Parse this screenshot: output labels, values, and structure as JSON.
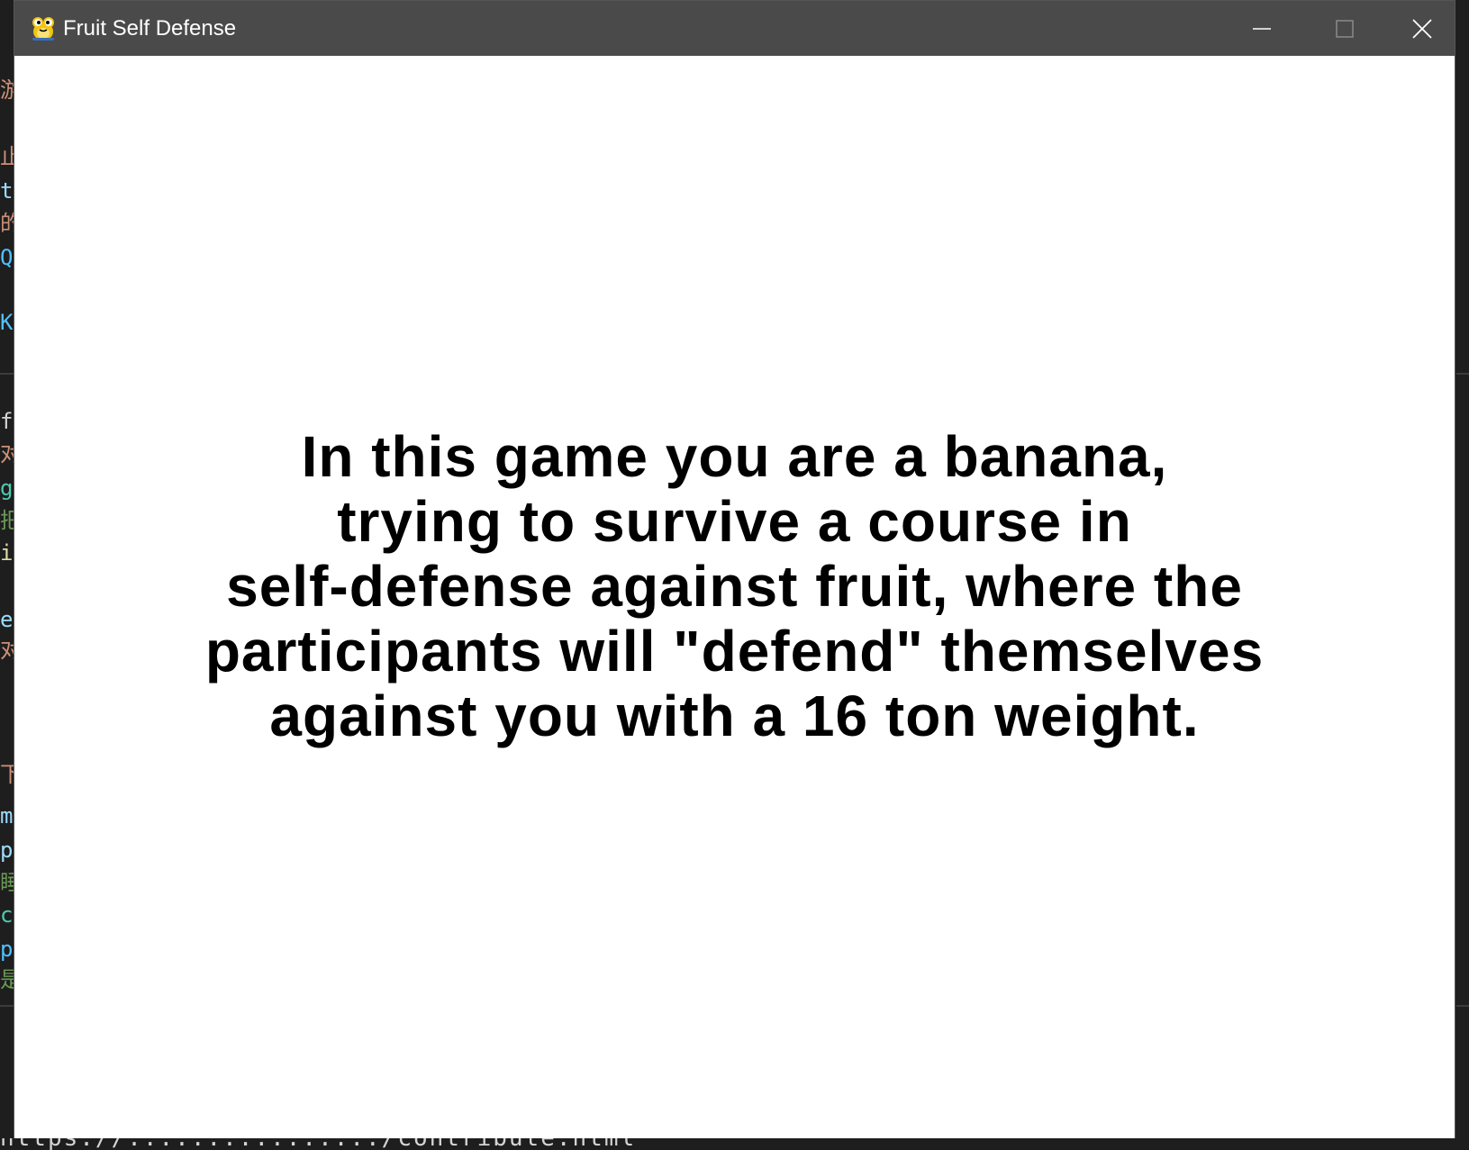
{
  "window": {
    "title": "Fruit Self Defense",
    "app_icon": "pygame-snake-icon",
    "controls": {
      "minimize_icon": "minimize-icon",
      "maximize_icon": "maximize-icon",
      "close_icon": "close-icon"
    }
  },
  "story": {
    "lines": [
      "In this game you are a banana,",
      "trying to survive a course in",
      "self-defense against fruit, where the",
      "participants will \"defend\" themselves",
      "against you with a 16 ton weight."
    ]
  },
  "colors": {
    "titlebar": "#4a4a4a",
    "client_background": "#ffffff",
    "text": "#000000",
    "desktop": "#1e1e1e"
  }
}
